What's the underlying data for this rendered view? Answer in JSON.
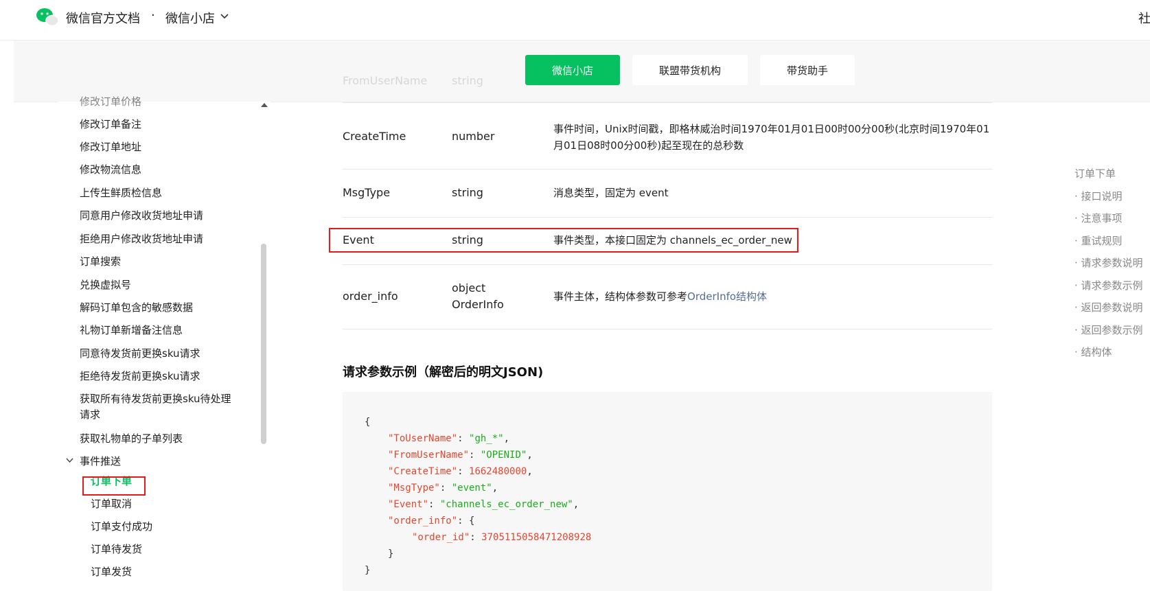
{
  "header": {
    "brand_title": "微信官方文档",
    "brand_dot": "·",
    "product": "微信小店",
    "right_text": "社"
  },
  "tabs": [
    {
      "label": "微信小店",
      "active": true
    },
    {
      "label": "联盟带货机构",
      "active": false
    },
    {
      "label": "带货助手",
      "active": false
    }
  ],
  "sidebar": {
    "partial_top_item": "修改订单价格",
    "items": [
      "修改订单备注",
      "修改订单地址",
      "修改物流信息",
      "上传生鲜质检信息",
      "同意用户修改收货地址申请",
      "拒绝用户修改收货地址申请",
      "订单搜索",
      "兑换虚拟号",
      "解码订单包含的敏感数据",
      "礼物订单新增备注信息",
      "同意待发货前更换sku请求",
      "拒绝待发货前更换sku请求",
      "获取所有待发货前更换sku待处理请求",
      "获取礼物单的子单列表"
    ],
    "folder_label": "事件推送",
    "event_items": [
      {
        "label": "订单下单",
        "active": true
      },
      {
        "label": "订单取消",
        "active": false
      },
      {
        "label": "订单支付成功",
        "active": false
      },
      {
        "label": "订单待发货",
        "active": false
      },
      {
        "label": "订单发货",
        "active": false
      }
    ]
  },
  "params_table": {
    "faded_row": {
      "name": "FromUserName",
      "type": "string"
    },
    "rows": [
      {
        "name": "CreateTime",
        "type": "number",
        "desc": "事件时间，Unix时间戳，即格林威治时间1970年01月01日00时00分00秒(北京时间1970年01月01日08时00分00秒)起至现在的总秒数"
      },
      {
        "name": "MsgType",
        "type": "string",
        "desc": "消息类型，固定为 event"
      },
      {
        "name": "Event",
        "type": "string",
        "desc": "事件类型，本接口固定为 channels_ec_order_new"
      },
      {
        "name": "order_info",
        "type": "object",
        "type2": "OrderInfo",
        "desc": "事件主体，结构体参数可参考",
        "desc_link": "OrderInfo结构体"
      }
    ]
  },
  "example": {
    "title": "请求参数示例（解密后的明文JSON)",
    "lines": {
      "open": "{",
      "to_key": "\"ToUserName\"",
      "to_val": "\"gh_*\"",
      "from_key": "\"FromUserName\"",
      "from_val": "\"OPENID\"",
      "time_key": "\"CreateTime\"",
      "time_val": "1662480000",
      "type_key": "\"MsgType\"",
      "type_val": "\"event\"",
      "event_key": "\"Event\"",
      "event_val": "\"channels_ec_order_new\"",
      "info_key": "\"order_info\"",
      "info_open": "{",
      "id_key": "\"order_id\"",
      "id_val": "3705115058471208928",
      "inner_close": "}",
      "close": "}"
    }
  },
  "toc": {
    "title": "订单下单",
    "items": [
      "· 接口说明",
      "· 注意事项",
      "· 重试规则",
      "· 请求参数说明",
      "· 请求参数示例",
      "· 返回参数说明",
      "· 返回参数示例",
      "· 结构体"
    ]
  },
  "colors": {
    "accent": "#07c160",
    "highlight_box": "#e5191b",
    "link": "#576b95"
  }
}
